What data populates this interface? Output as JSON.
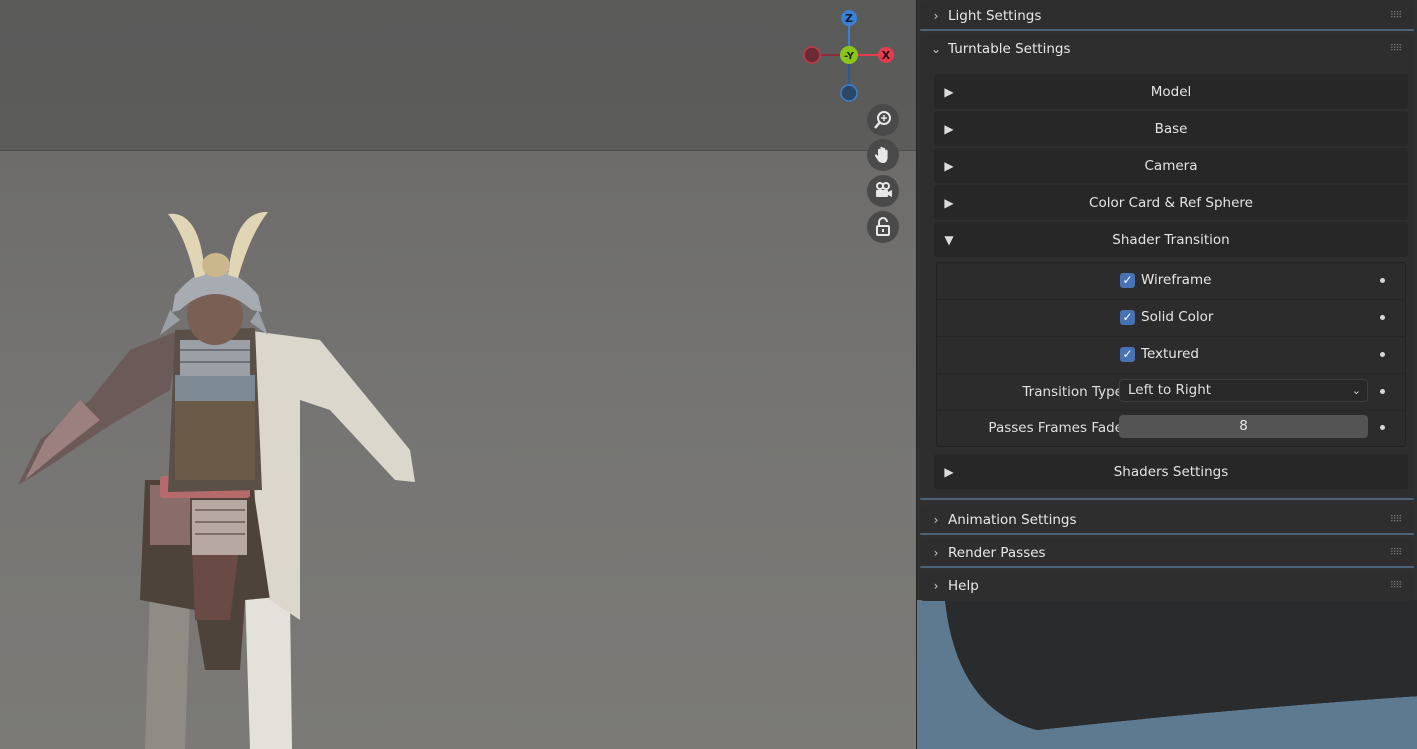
{
  "gizmo": {
    "z": "Z",
    "y": "-Y",
    "x": "X"
  },
  "viewport_icons": [
    "zoom-icon",
    "hand-pan-icon",
    "camera-icon",
    "lock-icon"
  ],
  "panels": {
    "light_settings": {
      "label": "Light Settings"
    },
    "turntable_settings": {
      "label": "Turntable Settings"
    },
    "animation_settings": {
      "label": "Animation Settings"
    },
    "render_passes": {
      "label": "Render Passes"
    },
    "help": {
      "label": "Help"
    }
  },
  "turntable": {
    "model": "Model",
    "base": "Base",
    "camera": "Camera",
    "color_card": "Color Card & Ref Sphere",
    "shader_transition": "Shader Transition",
    "shaders_settings": "Shaders Settings"
  },
  "shader_transition": {
    "wireframe": {
      "label": "Wireframe",
      "checked": true
    },
    "solid_color": {
      "label": "Solid Color",
      "checked": true
    },
    "textured": {
      "label": "Textured",
      "checked": true
    },
    "transition_type": {
      "label": "Transition Type",
      "value": "Left to Right"
    },
    "passes_frames_fade": {
      "label": "Passes Frames Fade",
      "value": "8"
    }
  },
  "colors": {
    "accent": "#4772b3",
    "x_axis": "#e23d4f",
    "y_axis": "#8bc41d",
    "z_axis": "#3a80d6"
  }
}
